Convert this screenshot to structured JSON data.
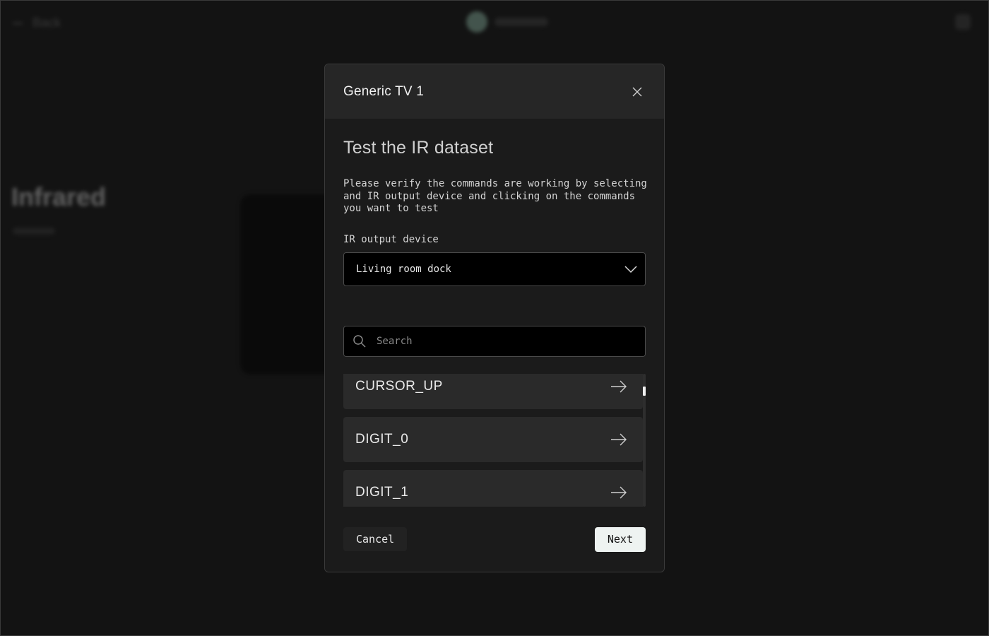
{
  "background": {
    "back_label": "Back",
    "page_title": "Infrared"
  },
  "modal": {
    "title": "Generic TV 1",
    "heading": "Test the IR dataset",
    "description": "Please verify the commands are working by selecting and IR output device and clicking on the commands you want to test",
    "output_label": "IR output device",
    "output_selected": "Living room dock",
    "search_placeholder": "Search",
    "commands": [
      "CURSOR_UP",
      "DIGIT_0",
      "DIGIT_1"
    ],
    "cancel_label": "Cancel",
    "next_label": "Next"
  },
  "icons": {
    "close": "close-icon",
    "dropdown": "chevron-down-icon",
    "search": "search-icon",
    "command_action": "arrow-right-icon"
  },
  "colors": {
    "background": "#1a1a1a",
    "modal_header": "#262626",
    "command_bg": "#2a2a2a",
    "primary_button": "#eef3f1"
  }
}
